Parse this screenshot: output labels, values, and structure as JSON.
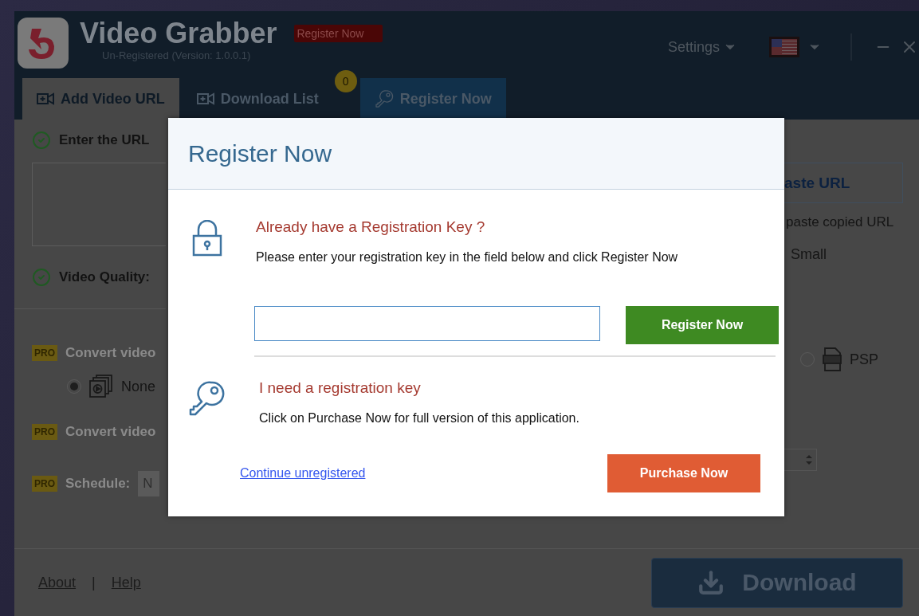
{
  "header": {
    "title": "Video Grabber",
    "register_badge": "Register Now",
    "subtitle": "Un-Registered (Version: 1.0.0.1)",
    "settings": "Settings"
  },
  "tabs": [
    {
      "label": "Add Video URL",
      "selected": true,
      "kind": "add"
    },
    {
      "label": "Download List",
      "selected": false,
      "kind": "list",
      "badge": "0"
    },
    {
      "label": "Register Now",
      "selected": false,
      "kind": "register"
    }
  ],
  "url_section": {
    "label": "Enter the URL",
    "paste_button": "aste URL",
    "paste_hint": "paste copied URL"
  },
  "quality": {
    "label": "Video Quality:",
    "option": "Small"
  },
  "convert_format": {
    "pro": "PRO",
    "label": "Convert video",
    "options": [
      {
        "label": "None",
        "selected": true,
        "kind": "none"
      },
      {
        "label": "PSP",
        "selected": false,
        "kind": "psp"
      }
    ]
  },
  "convert_audio": {
    "pro": "PRO",
    "label": "Convert video"
  },
  "schedule": {
    "pro": "PRO",
    "label": "Schedule:",
    "value": "N"
  },
  "footer": {
    "links": [
      "About",
      "Help"
    ],
    "separator": "|",
    "download": "Download"
  },
  "dialog": {
    "title": "Register Now",
    "have_key": {
      "heading": "Already have a Registration Key ?",
      "text": "Please enter your registration key in the field below and click Register Now",
      "button": "Register Now"
    },
    "need_key": {
      "heading": "I need a registration key",
      "text": "Click on Purchase Now for full version of this application."
    },
    "continue_link": "Continue unregistered",
    "purchase_button": "Purchase Now"
  }
}
